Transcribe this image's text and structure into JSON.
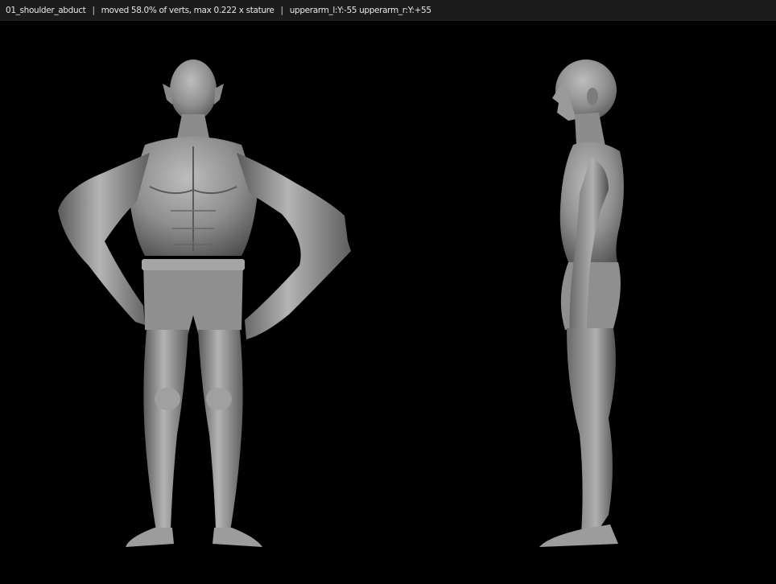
{
  "status_bar": {
    "pose_name": "01_shoulder_abduct",
    "separator": "|",
    "stats": "moved 58.0% of verts, max 0.222 x stature",
    "rotations": "upperarm_l:Y:-55 upperarm_r:Y:+55"
  },
  "viewport": {
    "background_color": "#000000",
    "mesh_color": "#9a9a9a",
    "views": [
      "front-view",
      "side-view"
    ]
  }
}
